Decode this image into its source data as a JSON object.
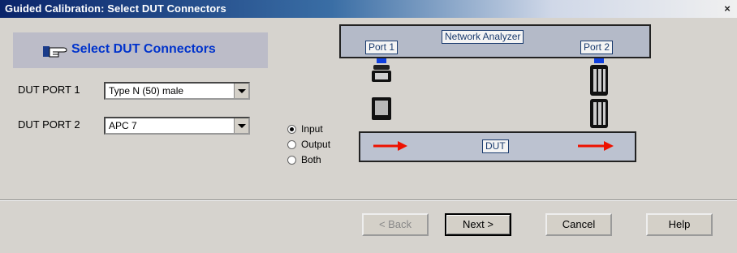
{
  "window": {
    "title": "Guided Calibration: Select DUT Connectors",
    "close_symbol": "×"
  },
  "header": {
    "title": "Select DUT Connectors"
  },
  "dut_port_1": {
    "label": "DUT PORT 1",
    "value": "Type N (50) male"
  },
  "dut_port_2": {
    "label": "DUT PORT 2",
    "value": "APC 7"
  },
  "direction": {
    "options": [
      "Input",
      "Output",
      "Both"
    ],
    "selected": "Input"
  },
  "diagram": {
    "analyzer_label": "Network Analyzer",
    "port1_label": "Port 1",
    "port2_label": "Port 2",
    "dut_label": "DUT"
  },
  "buttons": {
    "back": "< Back",
    "next": "Next >",
    "cancel": "Cancel",
    "help": "Help"
  },
  "colors": {
    "title_blue": "#0a246a",
    "header_text": "#0033cc",
    "arrow": "#ee1100",
    "port_blue": "#1040e0"
  }
}
